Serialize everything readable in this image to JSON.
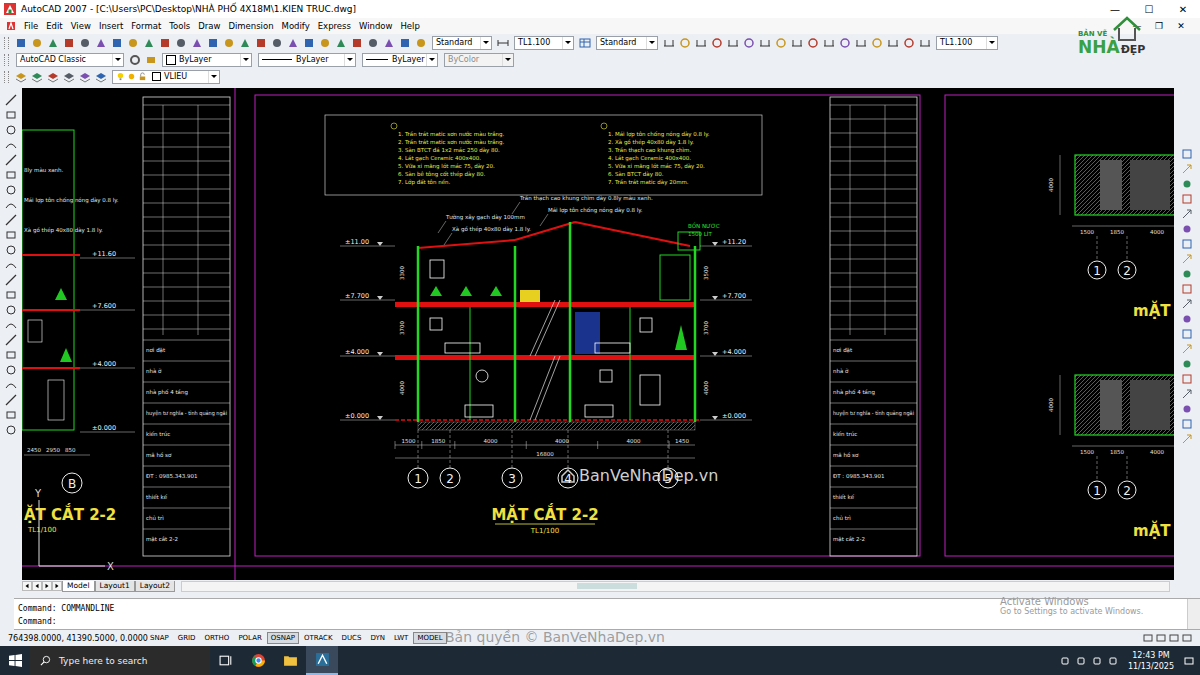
{
  "window": {
    "title": "AutoCAD 2007 - [C:\\Users\\PC\\Desktop\\NHÀ PHỐ 4X18M\\1.KIEN TRUC.dwg]",
    "controls": [
      "—",
      "☐",
      "✕"
    ],
    "doc_controls": [
      "—",
      "❐",
      "✕"
    ]
  },
  "menu": [
    "File",
    "Edit",
    "View",
    "Insert",
    "Format",
    "Tools",
    "Draw",
    "Dimension",
    "Modify",
    "Express",
    "Window",
    "Help"
  ],
  "toolbar": {
    "text_style": "Standard",
    "dim_scale": "TL1.100",
    "table_style": "Standard",
    "dim_style": "TL1.100"
  },
  "properties": {
    "workspace": "AutoCAD Classic",
    "color": "ByLayer",
    "linetype": "ByLayer",
    "lineweight": "ByLayer",
    "plot_style": "ByColor",
    "plot_style_disabled": true
  },
  "layer": {
    "name": "VLIEU"
  },
  "logo": {
    "top": "BẢN VẼ",
    "main": "NHÀ",
    "tail": "ĐẸP"
  },
  "drawing": {
    "main_sheet": {
      "notes_left": [
        "1. Trần trát matic sơn nước màu trắng.",
        "2. Trần trát matic sơn nước màu trắng.",
        "3. Sàn BTCT đá 1x2 mác 250 dày 80.",
        "4. Lát gạch Ceramic 400x400.",
        "5. Vữa xi măng lót mác 75, dày 20.",
        "6. Sàn bê tông cốt thép dày 80.",
        "7. Lớp đất tôn nền."
      ],
      "notes_right": [
        "1. Mái lợp tôn chống nóng dày 0.8 ly.",
        "2. Xà gồ thép 40x80 dày 1.8 ly.",
        "3. Trần thạch cao khung chìm.",
        "4. Lát gạch Ceramic 400x400.",
        "5. Vữa xi măng lót mác 75, dày 20.",
        "6. Sàn BTCT dày 80.",
        "7. Trần trát matic dày 20mm."
      ],
      "callouts": [
        "Trần thạch cao khung chìm dày 0.8ly màu xanh.",
        "Mái lợp tôn chống nóng dày 0.8 ly.",
        "Tường xây gạch dày 100mm",
        "Xà gồ thép 40x80 dày 1.8 ly."
      ],
      "tank": [
        "BỒN NƯỚC",
        "1500 LÍT"
      ],
      "levels_left": [
        "±11.00",
        "±7.700",
        "±4.000",
        "±0.000"
      ],
      "levels_right": [
        "+11.20",
        "+7.700",
        "+4.000",
        "±0.000"
      ],
      "heights_left": [
        "3300",
        "3700",
        "4000"
      ],
      "heights_right": [
        "3500",
        "3700",
        "4000"
      ],
      "spans": [
        "1500",
        "1850",
        "4000",
        "4000",
        "4000",
        "1450"
      ],
      "total": "16800",
      "axes": [
        "1",
        "2",
        "3",
        "4",
        "5"
      ],
      "title": "MẶT CẮT 2-2",
      "scale": "TL1/100"
    },
    "left_sheet": {
      "notes": [
        "8ly màu xanh.",
        "Mái lợp tôn chống nóng dày 0.8 ly.",
        "Xà gồ thép 40x80 dày 1.8 ly."
      ],
      "levels": [
        "+11.60",
        "+7.600",
        "+4.000",
        "±0.000"
      ],
      "spans": [
        "2450",
        "2950",
        "850"
      ],
      "axis": "B",
      "title": "ẶT CẮT 2-2",
      "scale": "TL1/100",
      "ucs": [
        "Y",
        "X"
      ]
    },
    "title_blocks": [
      {
        "rows": [
          "nơi đặt",
          "nhà ở",
          "nhà phố 4 tầng",
          "huyện tư nghĩa - tỉnh quảng ngãi",
          "kiến trúc",
          "mã hồ sơ",
          "ĐT : 0985.343.901",
          "thiết kế",
          "chủ trì",
          "mặt cắt 2-2"
        ]
      },
      {
        "rows": [
          "nơi đặt",
          "nhà ở",
          "nhà phố 4 tầng",
          "huyện tư nghĩa - tỉnh quảng ngãi",
          "kiến trúc",
          "mã hồ sơ",
          "ĐT : 0985.343.901",
          "thiết kế",
          "chủ trì",
          "mặt cắt 2-2"
        ]
      }
    ],
    "right_plans": [
      {
        "spans": [
          "1500",
          "1850",
          "4000"
        ],
        "height": "4000",
        "axes": [
          "1",
          "2"
        ],
        "title": "mẶT"
      },
      {
        "spans": [
          "1500",
          "1850",
          "4000"
        ],
        "height": "4000",
        "axes": [
          "1",
          "2"
        ],
        "title": "mẶT"
      }
    ]
  },
  "layout_tabs": [
    {
      "label": "Model",
      "selected": true
    },
    {
      "label": "Layout1",
      "selected": false
    },
    {
      "label": "Layout2",
      "selected": false
    }
  ],
  "command": {
    "lines": [
      "Command: COMMANDLINE",
      "Command:"
    ]
  },
  "status": {
    "coords": "764398.0000, 41390.5000, 0.0000",
    "toggles": [
      {
        "label": "SNAP",
        "on": false
      },
      {
        "label": "GRID",
        "on": false
      },
      {
        "label": "ORTHO",
        "on": false
      },
      {
        "label": "POLAR",
        "on": false
      },
      {
        "label": "OSNAP",
        "on": true
      },
      {
        "label": "OTRACK",
        "on": false
      },
      {
        "label": "DUCS",
        "on": false
      },
      {
        "label": "DYN",
        "on": false
      },
      {
        "label": "LWT",
        "on": false
      },
      {
        "label": "MODEL",
        "on": true
      }
    ]
  },
  "watermarks": {
    "center": "BanVeNhaDep.vn",
    "copyright": "Bản quyền © BanVeNhaDep.vn",
    "activate": [
      "Activate Windows",
      "Go to Settings to activate Windows."
    ]
  },
  "taskbar": {
    "search": "Type here to search",
    "time": "12:43 PM",
    "date": "11/13/2025"
  }
}
